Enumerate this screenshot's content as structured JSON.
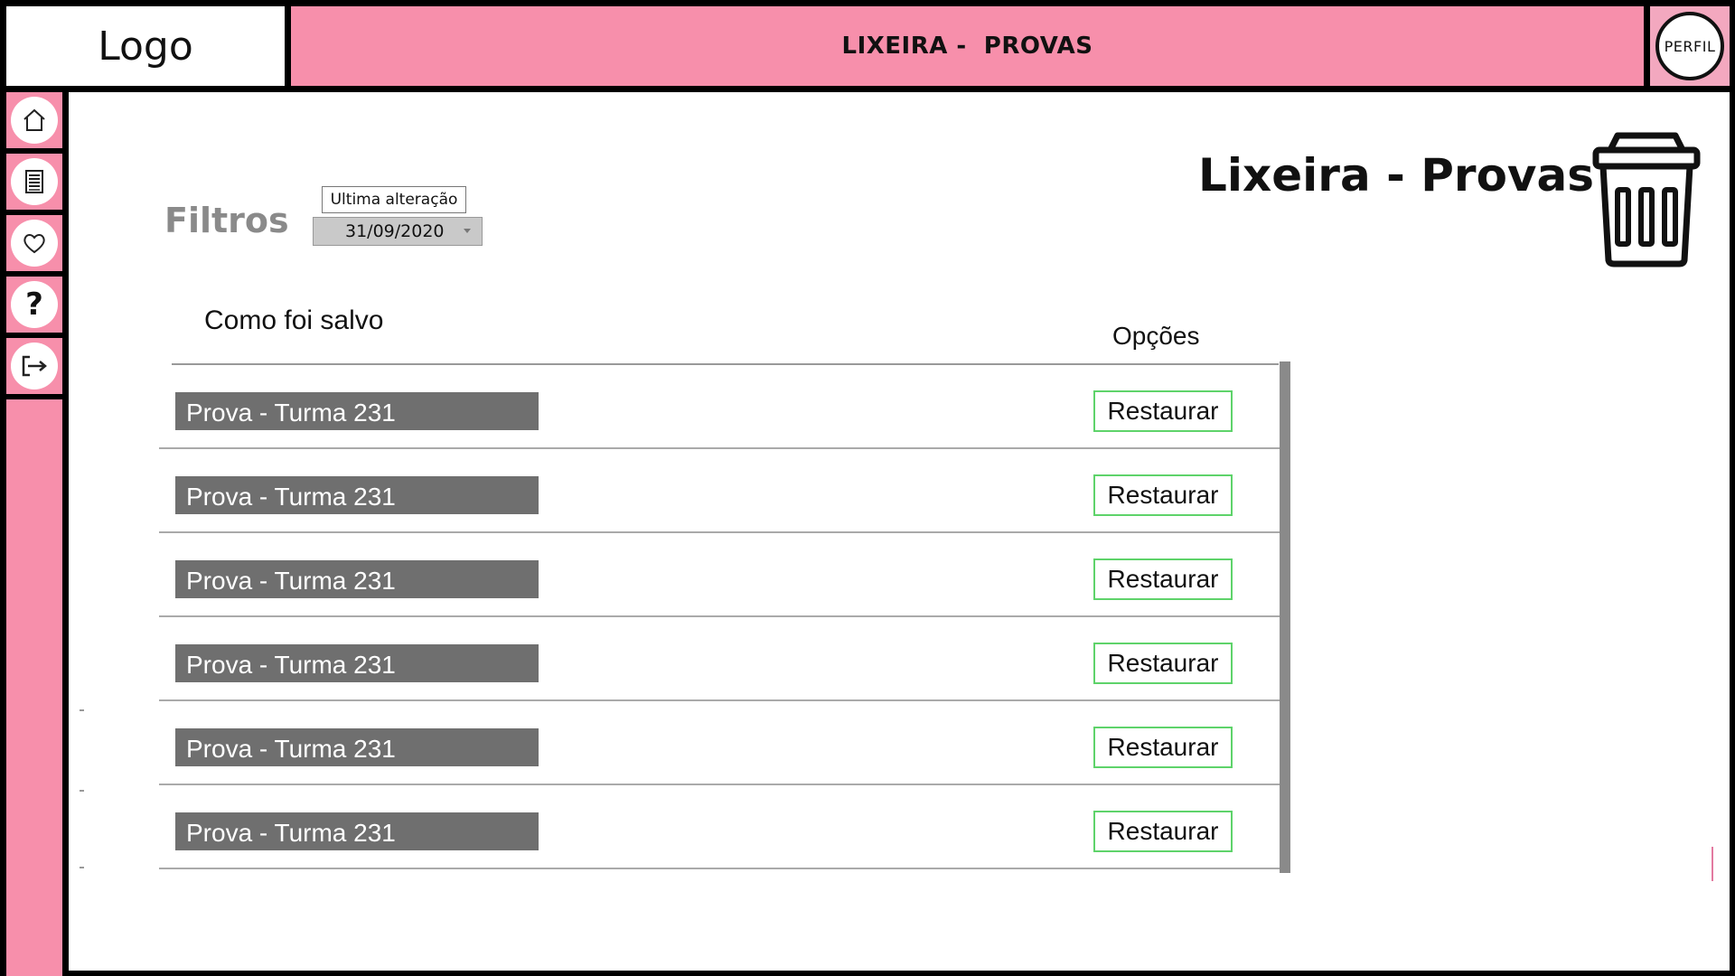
{
  "header": {
    "logo_text": "Logo",
    "title": "LIXEIRA -  PROVAS",
    "profile_label": "PERFIL"
  },
  "sidebar": {
    "items": [
      {
        "icon": "home-icon"
      },
      {
        "icon": "document-icon"
      },
      {
        "icon": "heart-icon"
      },
      {
        "icon": "help-icon",
        "glyph": "?"
      },
      {
        "icon": "logout-icon"
      }
    ]
  },
  "main": {
    "page_title": "Lixeira - Provas",
    "filters": {
      "label": "Filtros",
      "date_caption": "Ultima alteração",
      "date_value": "31/09/2020"
    },
    "table": {
      "col_name": "Como foi salvo",
      "col_options": "Opções",
      "rows": [
        {
          "name": "Prova - Turma 231",
          "action": "Restaurar"
        },
        {
          "name": "Prova - Turma 231",
          "action": "Restaurar"
        },
        {
          "name": "Prova - Turma 231",
          "action": "Restaurar"
        },
        {
          "name": "Prova - Turma 231",
          "action": "Restaurar"
        },
        {
          "name": "Prova - Turma 231",
          "action": "Restaurar"
        },
        {
          "name": "Prova - Turma 231",
          "action": "Restaurar"
        }
      ]
    }
  },
  "colors": {
    "accent_pink": "#f78fab",
    "restore_border": "#5ed36a",
    "row_label_bg": "#6f6f6f"
  }
}
